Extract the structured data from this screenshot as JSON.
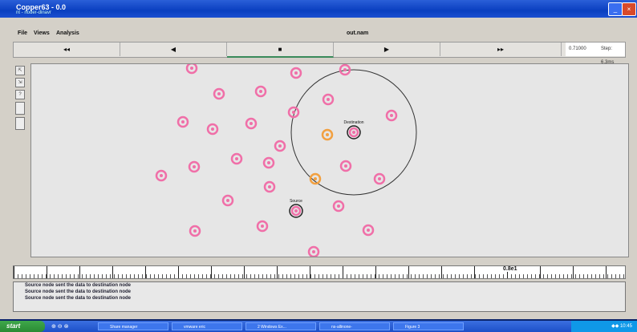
{
  "window": {
    "title": "Copper63 - 0.0",
    "subtitle": "nt - noder-dinavr"
  },
  "menu": {
    "file": "File",
    "views": "Views",
    "analysis": "Analysis",
    "filename": "out.nam"
  },
  "toolbar": {
    "rewind": "◂◂",
    "back": "◀",
    "stop": "■",
    "play": "▶",
    "fastforward": "▸▸",
    "time_label": "0.71000",
    "step_label": "Step: 6.3ms"
  },
  "tools": [
    "⇱",
    "⇲",
    "?",
    "",
    ""
  ],
  "nodes": {
    "destination_label": "Destination",
    "source_label": "Source"
  },
  "timeline": {
    "label": "0.8e1"
  },
  "log": [
    "Source node sent the data to destination node",
    "Source node sent the data to destination node",
    "Source node sent the data to destination node"
  ],
  "taskbar": {
    "start": "start",
    "quicklaunch": "⊕ ⊖ ⊗",
    "buttons": [
      "Share manager",
      "vmware eric",
      "2 Windows Ex...",
      "ns-allinone-",
      "Figure 3"
    ],
    "tray": "◆◆ 10:45"
  },
  "colors": {
    "node_pink": "#f06fa8",
    "node_orange": "#f2a040",
    "node_dark": "#222222"
  }
}
